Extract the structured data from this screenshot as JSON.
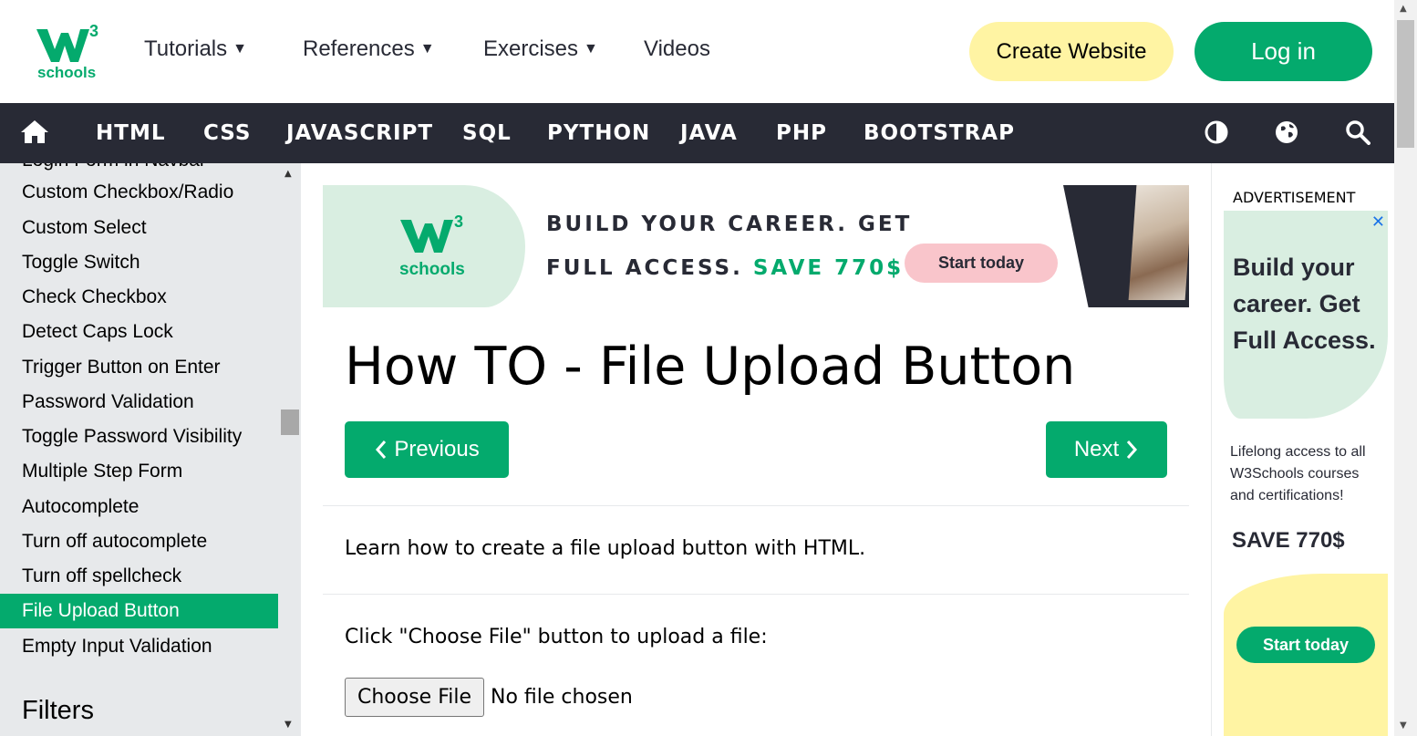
{
  "brand": {
    "logo_sup": "3",
    "logo_word": "schools",
    "green": "#04aa6d",
    "dark": "#282a35"
  },
  "topnav": {
    "items": [
      {
        "label": "Tutorials",
        "caret": "▼"
      },
      {
        "label": "References",
        "caret": "▼"
      },
      {
        "label": "Exercises",
        "caret": "▼"
      },
      {
        "label": "Videos"
      }
    ],
    "create_website": "Create Website",
    "login": "Log in"
  },
  "darknav": {
    "items": [
      "HTML",
      "CSS",
      "JAVASCRIPT",
      "SQL",
      "PYTHON",
      "JAVA",
      "PHP",
      "BOOTSTRAP"
    ],
    "icons": [
      "home-icon",
      "contrast-icon",
      "globe-icon",
      "search-icon"
    ]
  },
  "sidebar": {
    "partial_top": "Login Form in Navbar",
    "links": [
      "Custom Checkbox/Radio",
      "Custom Select",
      "Toggle Switch",
      "Check Checkbox",
      "Detect Caps Lock",
      "Trigger Button on Enter",
      "Password Validation",
      "Toggle Password Visibility",
      "Multiple Step Form",
      "Autocomplete",
      "Turn off autocomplete",
      "Turn off spellcheck",
      "File Upload Button",
      "Empty Input Validation"
    ],
    "active": "File Upload Button",
    "section_heading": "Filters"
  },
  "banner": {
    "sup": "3",
    "word": "schools",
    "line1": "BUILD YOUR CAREER. GET",
    "line2_prefix": "FULL ACCESS. ",
    "line2_save": "SAVE 770$",
    "cta": "Start today"
  },
  "main": {
    "title": "How TO - File Upload Button",
    "previous": "Previous",
    "next": "Next",
    "intro": "Learn how to create a file upload button with HTML.",
    "instruction": "Click \"Choose File\" button to upload a file:",
    "choose_file": "Choose File",
    "no_file": "No file chosen"
  },
  "ad": {
    "label": "ADVERTISEMENT",
    "close": "✕",
    "headline": [
      "Build your",
      "career. Get",
      "Full Access."
    ],
    "sub": [
      "Lifelong access to all",
      "W3Schools courses",
      "and certifications!"
    ],
    "save": "SAVE 770$",
    "cta": "Start today"
  }
}
